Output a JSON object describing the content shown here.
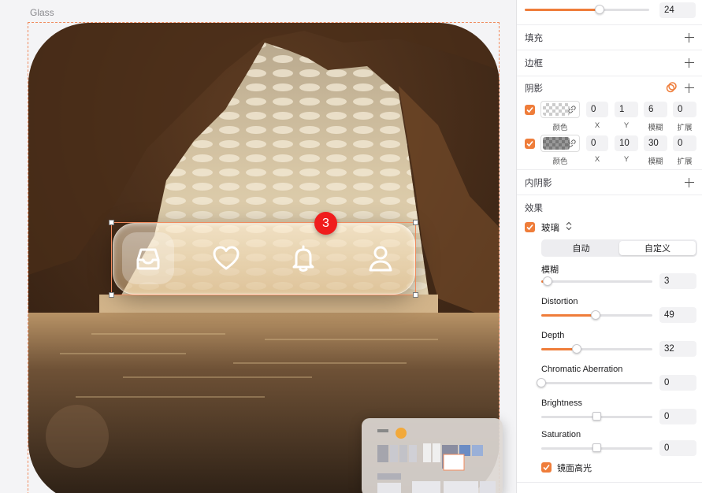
{
  "canvas": {
    "frame_label": "Glass",
    "tab_bar": {
      "tabs": [
        {
          "icon": "inbox-icon",
          "active": true
        },
        {
          "icon": "heart-icon",
          "active": false
        },
        {
          "icon": "bell-icon",
          "active": false
        },
        {
          "icon": "user-icon",
          "active": false
        }
      ],
      "badge_count": "3"
    }
  },
  "panel": {
    "top_slider_value": "24",
    "top_slider_fraction": 0.6,
    "sections": {
      "fill": "填充",
      "border": "边框",
      "shadow": "阴影",
      "inner_shadow": "内阴影",
      "effects": "效果"
    },
    "shadows": [
      {
        "enabled": true,
        "x": "0",
        "y": "1",
        "blur": "6",
        "spread": "0"
      },
      {
        "enabled": true,
        "x": "0",
        "y": "10",
        "blur": "30",
        "spread": "0"
      }
    ],
    "shadow_captions": {
      "color": "颜色",
      "x": "X",
      "y": "Y",
      "blur": "模糊",
      "spread": "扩展"
    },
    "glass": {
      "enabled": true,
      "label": "玻璃",
      "modes": [
        "自动",
        "自定义"
      ],
      "selected_mode": "自定义",
      "params": [
        {
          "label": "模糊",
          "value": "3",
          "fraction": 0.06
        },
        {
          "label": "Distortion",
          "value": "49",
          "fraction": 0.49
        },
        {
          "label": "Depth",
          "value": "32",
          "fraction": 0.32
        },
        {
          "label": "Chromatic Aberration",
          "value": "0",
          "fraction": 0.0
        },
        {
          "label": "Brightness",
          "value": "0",
          "fraction": 0.5
        },
        {
          "label": "Saturation",
          "value": "0",
          "fraction": 0.5
        }
      ],
      "specular": {
        "enabled": true,
        "label": "镜面高光"
      }
    },
    "accent_color": "#ef7d3a"
  }
}
